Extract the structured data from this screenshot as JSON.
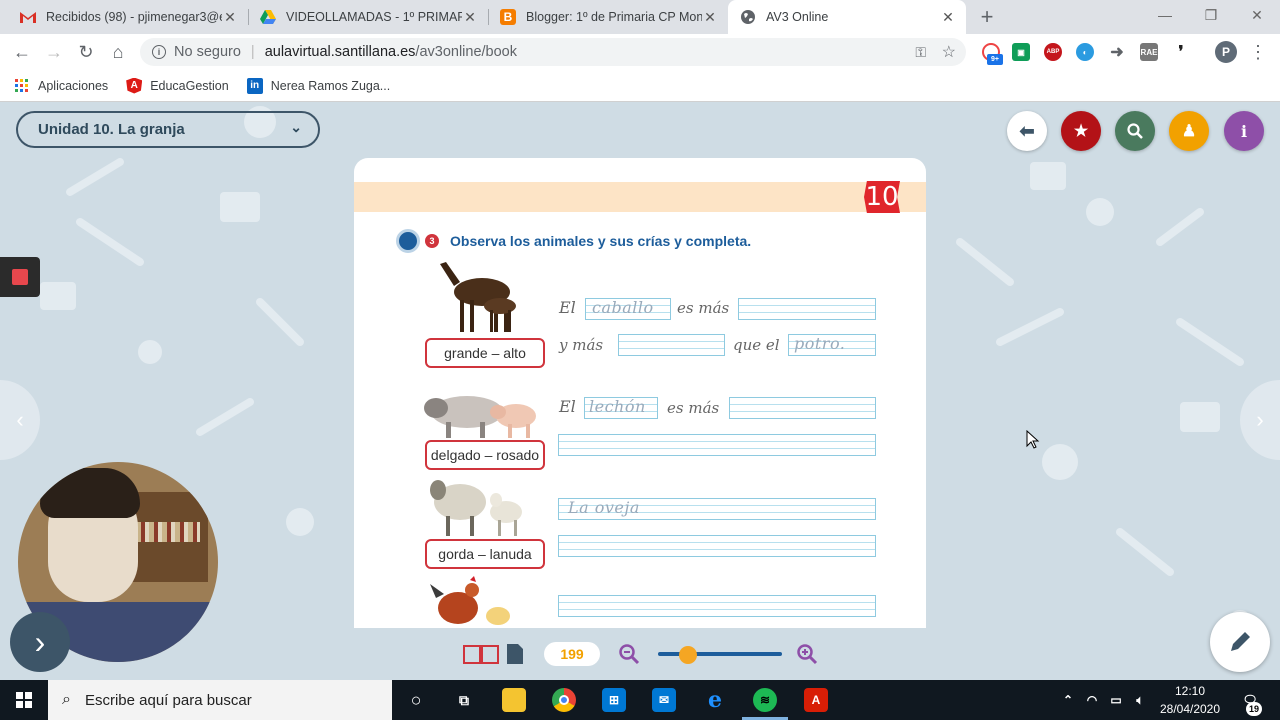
{
  "tabs": [
    {
      "title": "Recibidos (98) - pjimenegar3@ed",
      "icon": "gmail-icon"
    },
    {
      "title": "VIDEOLLAMADAS - 1º PRIMARIA",
      "icon": "drive-icon"
    },
    {
      "title": "Blogger: 1º de Primaria CP Mont",
      "icon": "blogger-icon"
    },
    {
      "title": "AV3 Online",
      "icon": "globe-icon"
    }
  ],
  "address": {
    "security": "No seguro",
    "url_host": "aulavirtual.santillana.es",
    "url_path": "/av3online/book"
  },
  "bookmarks": [
    {
      "label": "Aplicaciones",
      "icon": "apps-grid-icon"
    },
    {
      "label": "EducaGestion",
      "icon": "angular-icon"
    },
    {
      "label": "Nerea Ramos Zuga...",
      "icon": "linkedin-icon"
    }
  ],
  "extensions": {
    "badge": "9+",
    "abp": "ABP",
    "profile_initial": "P"
  },
  "app": {
    "unit_title": "Unidad 10. La granja",
    "page_badge": "10",
    "exercise_number": "3",
    "exercise_title": "Observa los animales y sus crías y completa.",
    "labels": [
      "grande – alto",
      "delgado – rosado",
      "gorda – lanuda"
    ],
    "sentences": {
      "s1_el": "El",
      "s1_traced": "caballo",
      "s1_mas": "es más",
      "s2_y": "y más",
      "s2_que": "que el",
      "s2_traced": "potro.",
      "s3_el": "El",
      "s3_traced": "lechón",
      "s3_mas": "es más",
      "s4_traced": "La oveja"
    },
    "current_page": "199",
    "zoom_level": 0.2
  },
  "taskbar": {
    "search_placeholder": "Escribe aquí para buscar",
    "time": "12:10",
    "date": "28/04/2020",
    "notifications": "19"
  },
  "colors": {
    "accent_blue": "#1d5d9b",
    "label_red": "#d0343c",
    "star_red": "#b31217",
    "search_green": "#4a7a5e",
    "person_yellow": "#f2a100",
    "info_purple": "#8e4fa8"
  }
}
